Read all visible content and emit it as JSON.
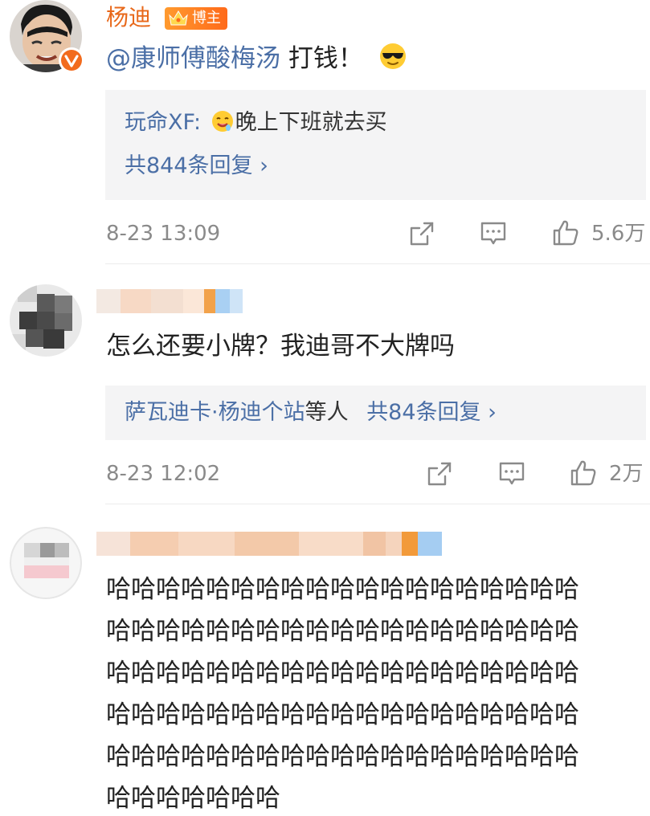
{
  "comments": [
    {
      "username": "杨迪",
      "badge": "博主",
      "mention": "@康师傅酸梅汤",
      "text": " 打钱！",
      "emoji_icon": "sunglasses-emoji",
      "reply": {
        "name": "玩命XF",
        "emoji_icon": "drooling-emoji",
        "text": "晚上下班就去买",
        "count_label": "共844条回复 ›"
      },
      "time": "8-23 13:09",
      "likes": "5.6万"
    },
    {
      "username": "",
      "text": "怎么还要小牌？我迪哥不大牌吗",
      "reply": {
        "names": "萨瓦迪卡·杨迪个站",
        "suffix": "等人",
        "count_label": "共84条回复 ›"
      },
      "time": "8-23 12:02",
      "likes": "2万"
    },
    {
      "username": "",
      "text_lines": [
        "哈哈哈哈哈哈哈哈哈哈哈哈哈哈哈哈哈哈哈",
        "哈哈哈哈哈哈哈哈哈哈哈哈哈哈哈哈哈哈哈",
        "哈哈哈哈哈哈哈哈哈哈哈哈哈哈哈哈哈哈哈",
        "哈哈哈哈哈哈哈哈哈哈哈哈哈哈哈哈哈哈哈",
        "哈哈哈哈哈哈哈哈哈哈哈哈哈哈哈哈哈哈哈",
        "哈哈哈哈哈哈哈"
      ]
    }
  ],
  "colors": {
    "link": "#4b6fa6",
    "meta": "#8a8a8a",
    "reply_bg": "#f4f4f5",
    "verified": "#f26b1d"
  }
}
